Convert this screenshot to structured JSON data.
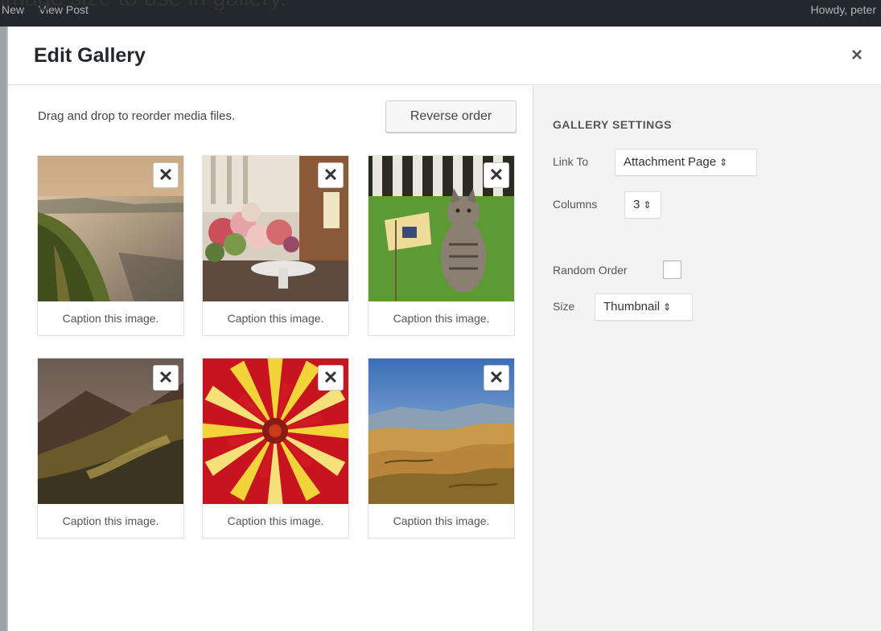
{
  "tutorial_caption": "image size to use in gallery.",
  "adminbar": {
    "items": [
      "New",
      "View Post"
    ],
    "greeting": "Howdy, peter"
  },
  "modal": {
    "title": "Edit Gallery",
    "close_label": "×",
    "hint": "Drag and drop to reorder media files.",
    "reverse_label": "Reverse order"
  },
  "gallery": {
    "remove_label": "✕",
    "items": [
      {
        "caption": "Caption this image.",
        "subject": "coastal cliff at sunset"
      },
      {
        "caption": "Caption this image.",
        "subject": "flower bouquet on table"
      },
      {
        "caption": "Caption this image.",
        "subject": "tabby cat on grass with flag"
      },
      {
        "caption": "Caption this image.",
        "subject": "misty mountain valley"
      },
      {
        "caption": "Caption this image.",
        "subject": "red yellow dahlia flower"
      },
      {
        "caption": "Caption this image.",
        "subject": "golden hills landscape"
      }
    ]
  },
  "settings": {
    "heading": "GALLERY SETTINGS",
    "link_to": {
      "label": "Link To",
      "value": "Attachment Page"
    },
    "columns": {
      "label": "Columns",
      "value": "3"
    },
    "random_order": {
      "label": "Random Order",
      "checked": false
    },
    "size": {
      "label": "Size",
      "value": "Thumbnail"
    },
    "select_arrow": "⇕"
  }
}
